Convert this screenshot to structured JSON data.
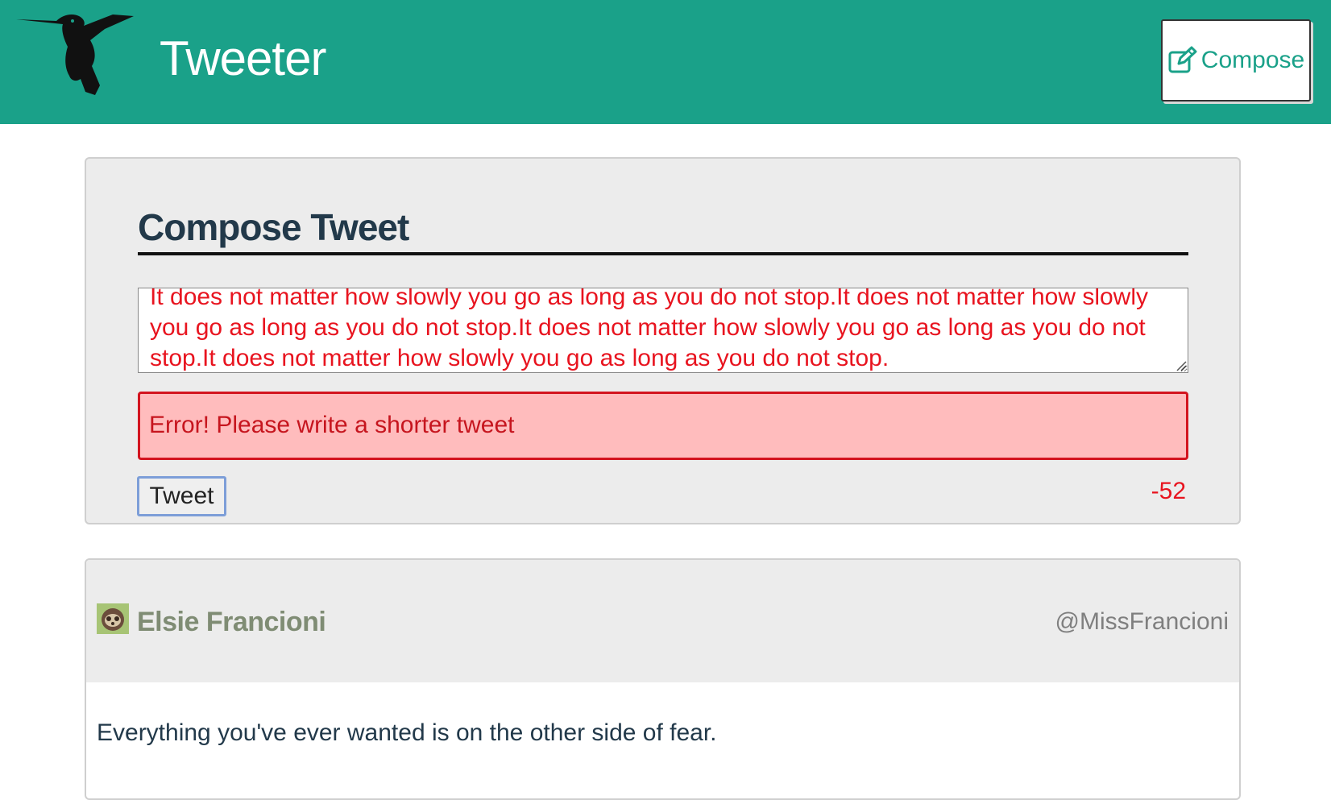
{
  "nav": {
    "brand": "Tweeter",
    "compose_label": "Compose",
    "colors": {
      "background": "#1aa189",
      "text": "#ffffff"
    }
  },
  "compose": {
    "title": "Compose Tweet",
    "text": "It does not matter how slowly you go as long as you do not stop.It does not matter how slowly you go as long as you do not stop.It does not matter how slowly you go as long as you do not stop.It does not matter how slowly you go as long as you do not stop.",
    "error": "Error! Please write a shorter tweet",
    "tweet_button": "Tweet",
    "counter": "-52",
    "colors": {
      "error_text": "#e8141f",
      "error_bg": "#ffbcbd"
    }
  },
  "tweets": [
    {
      "name": "Elsie Francioni",
      "handle": "@MissFrancioni",
      "text": "Everything you've ever wanted is on the other side of fear.",
      "avatar_icon": "sloth-avatar-icon"
    }
  ],
  "icons": {
    "logo": "hummingbird-icon",
    "compose": "pencil-square-icon",
    "resize": "resize-grip-icon"
  }
}
